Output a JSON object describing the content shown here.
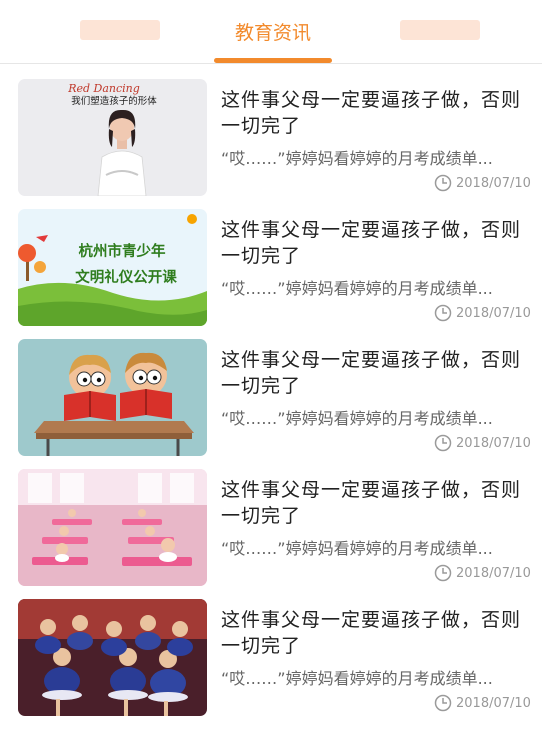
{
  "tabs": {
    "active_label": "教育资讯"
  },
  "thumb_texts": {
    "dance_brand": "Red Dancing",
    "dance_caption": "我们塑造孩子的形体",
    "civil_line1": "杭州市青少年",
    "civil_line2": "文明礼仪公开课"
  },
  "news": [
    {
      "title": "这件事父母一定要逼孩子做，否则一切完了",
      "summary": "“哎……”婷婷妈看婷婷的月考成绩单...",
      "date": "2018/07/10",
      "thumb": "woman-teacher"
    },
    {
      "title": "这件事父母一定要逼孩子做，否则一切完了",
      "summary": "“哎……”婷婷妈看婷婷的月考成绩单...",
      "date": "2018/07/10",
      "thumb": "civility-banner"
    },
    {
      "title": "这件事父母一定要逼孩子做，否则一切完了",
      "summary": "“哎……”婷婷妈看婷婷的月考成绩单...",
      "date": "2018/07/10",
      "thumb": "cartoon-readers"
    },
    {
      "title": "这件事父母一定要逼孩子做，否则一切完了",
      "summary": "“哎……”婷婷妈看婷婷的月考成绩单...",
      "date": "2018/07/10",
      "thumb": "dance-class"
    },
    {
      "title": "这件事父母一定要逼孩子做，否则一切完了",
      "summary": "“哎……”婷婷妈看婷婷的月考成绩单...",
      "date": "2018/07/10",
      "thumb": "stage-performance"
    }
  ],
  "colors": {
    "accent": "#f28a2c",
    "title": "#222222",
    "summary": "#666666",
    "date": "#999999"
  },
  "icons": {
    "date_icon": "clock-icon"
  }
}
